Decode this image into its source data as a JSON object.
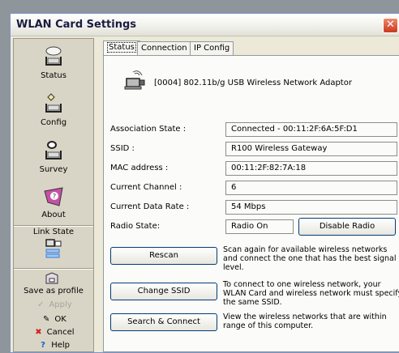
{
  "window": {
    "title": "WLAN Card Settings",
    "close_glyph": "✕"
  },
  "sidebar": {
    "items": [
      {
        "label": "Status",
        "icon": "status-icon"
      },
      {
        "label": "Config",
        "icon": "config-icon"
      },
      {
        "label": "Survey",
        "icon": "survey-icon"
      },
      {
        "label": "About",
        "icon": "about-icon"
      }
    ],
    "link_state": {
      "label": "Link State",
      "icon": "link-state-icon"
    },
    "actions": {
      "save_profile": "Save as profile",
      "apply": "Apply",
      "ok": "OK",
      "cancel": "Cancel",
      "help": "Help"
    }
  },
  "tabs": [
    "Status",
    "Connection",
    "IP Config"
  ],
  "adapter": {
    "name": "[0004] 802.11b/g USB Wireless Network Adaptor",
    "icon": "usb-adapter-icon"
  },
  "status_rows": [
    {
      "label": "Association State :",
      "value": "Connected - 00:11:2F:6A:5F:D1"
    },
    {
      "label": "SSID :",
      "value": "R100 Wireless Gateway"
    },
    {
      "label": "MAC address :",
      "value": "00:11:2F:82:7A:18"
    },
    {
      "label": "Current Channel :",
      "value": "6"
    },
    {
      "label": "Current Data Rate :",
      "value": "54 Mbps"
    },
    {
      "label": "Radio State:",
      "value": "Radio On"
    }
  ],
  "buttons": {
    "disable_radio": "Disable Radio",
    "rescan": "Rescan",
    "change_ssid": "Change SSID",
    "search_connect": "Search & Connect"
  },
  "descriptions": {
    "rescan": "Scan again for available wireless networks and connect the one that has the best signal level.",
    "change_ssid": "To connect to one wireless network, your WLAN Card and wireless network must specify the same SSID.",
    "search_connect": "View the wireless networks that are within range of this computer."
  },
  "colors": {
    "title_text": "#1b1b40",
    "close_button": "#d84a2b",
    "cancel_icon": "#d42020",
    "help_icon": "#1c5ec7"
  }
}
